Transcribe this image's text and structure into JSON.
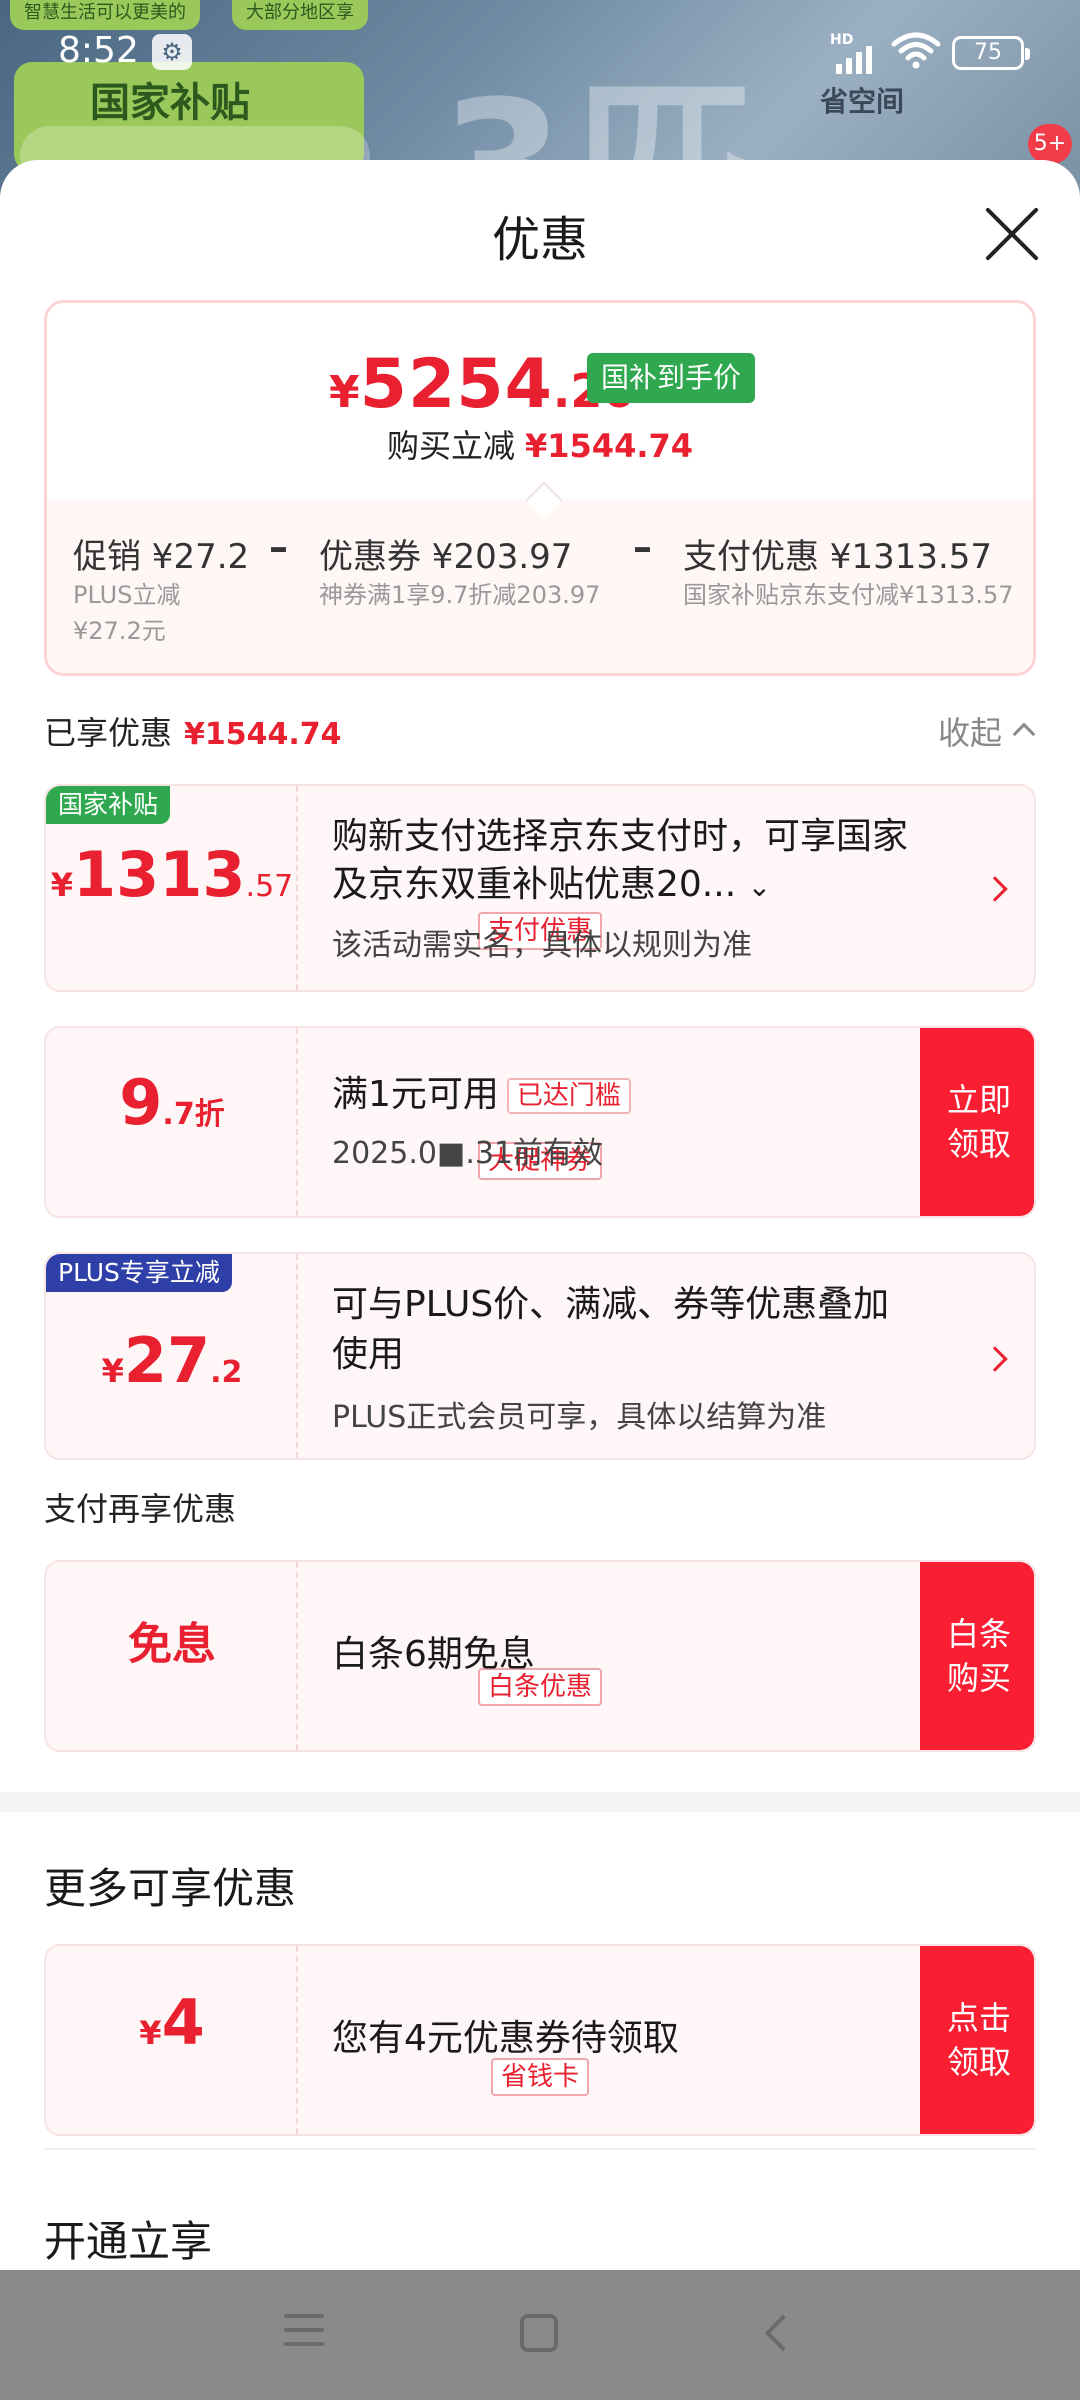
{
  "status": {
    "time": "8:52",
    "battery": "75",
    "hd": "HD"
  },
  "background": {
    "chip1": "智慧生活可以更美的",
    "chip2": "大部分地区享",
    "green_banner": "国家补贴",
    "big_text": "3匹",
    "right_text": "省空间",
    "badge": "5+"
  },
  "sheet": {
    "title": "优惠"
  },
  "summary": {
    "price_yen": "¥",
    "price_int": "5254",
    "price_dec": ".26",
    "price_tag": "国补到手价",
    "reduce_label": "购买立减",
    "reduce_amount": "¥1544.74",
    "items": [
      {
        "title": "促销 ¥27.2",
        "sub1": "PLUS立减",
        "sub2": "¥27.2元"
      },
      {
        "title": "优惠券 ¥203.97",
        "sub1": "神券满1享9.7折减203.97"
      },
      {
        "title": "支付优惠 ¥1313.57",
        "sub1": "国家补贴京东支付减¥1313.57"
      }
    ],
    "minus": "–"
  },
  "enjoyed": {
    "label": "已享优惠",
    "amount": "¥1544.74",
    "collapse": "收起"
  },
  "offers": {
    "subsidy": {
      "corner": "国家补贴",
      "yen": "¥",
      "int": "1313",
      "dec": ".57",
      "label": "支付优惠",
      "desc1": "购新支付选择京东支付时，可享国家",
      "desc2": "及京东双重补贴优惠20...",
      "sub": "该活动需实名，具体以规则为准"
    },
    "coupon": {
      "int": "9",
      "dec": ".7折",
      "label": "大促神券",
      "desc": "满1元可用",
      "tag": "已达门槛",
      "sub": "2025.0■.31前有效",
      "action": "立即领取"
    },
    "plus": {
      "corner": "PLUS专享立减",
      "yen": "¥",
      "int": "27",
      "dec": ".2",
      "desc1": "可与PLUS价、满减、券等优惠叠加",
      "desc2": "使用",
      "sub": "PLUS正式会员可享，具体以结算为准"
    },
    "pay_section": "支付再享优惠",
    "baitiao": {
      "amount": "免息",
      "label": "白条优惠",
      "desc": "白条6期免息",
      "action": "白条购买"
    }
  },
  "more": {
    "title": "更多可享优惠",
    "card": {
      "yen": "¥",
      "int": "4",
      "label": "省钱卡",
      "desc": "您有4元优惠券待领取",
      "action": "点击领取"
    },
    "open_title": "开通立享"
  },
  "colors": {
    "accent": "#fa1e32",
    "green": "#2fa84f",
    "plus_blue": "#2f3fa8"
  }
}
